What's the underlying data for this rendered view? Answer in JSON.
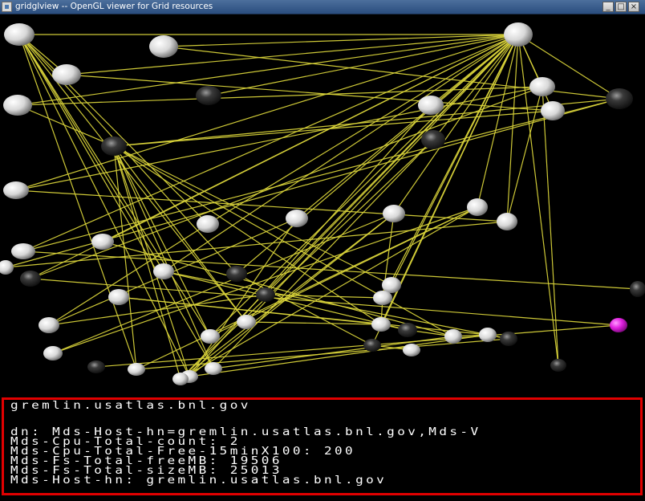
{
  "window": {
    "title": "gridglview -- OpenGL viewer for Grid resources"
  },
  "info_panel": {
    "hostname": "gremlin.usatlas.bnl.gov",
    "dn": "dn: Mds-Host-hn=gremlin.usatlas.bnl.gov,Mds-V",
    "cpu_count": "Mds-Cpu-Total-count: 2",
    "cpu_free": "Mds-Cpu-Total-Free-15minX100: 200",
    "fs_free": "Mds-Fs-Total-freeMB: 19506",
    "fs_size": "Mds-Fs-Total-sizeMB: 25013",
    "host_hn": "Mds-Host-hn: gremlin.usatlas.bnl.gov"
  },
  "scene": {
    "edge_color": "#d9d33a",
    "selected_node_color": "#e020e0",
    "highlight_border_color": "#e10000"
  }
}
